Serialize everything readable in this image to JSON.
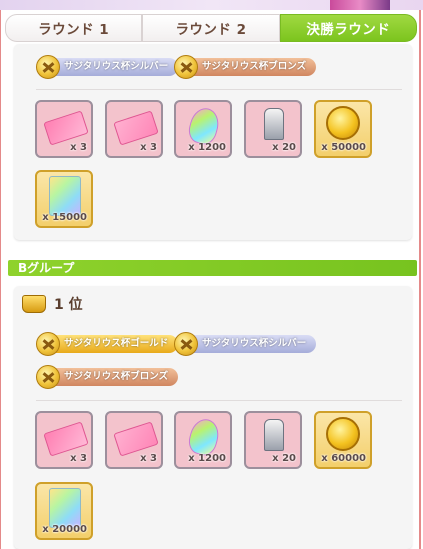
{
  "tabs": [
    "ラウンド 1",
    "ラウンド 2",
    "決勝ラウンド"
  ],
  "group_b": {
    "label": "Bグループ",
    "place_label": "1 位",
    "badges": [
      "サジタリウス杯ゴールド",
      "サジタリウス杯シルバー",
      "サジタリウス杯ブロンズ"
    ]
  },
  "section1": {
    "badges": [
      "サジタリウス杯シルバー",
      "サジタリウス杯ブロンズ"
    ],
    "items": [
      {
        "icon": "pink-ticket-icon",
        "qty": "x 3"
      },
      {
        "icon": "pink-ticket-icon",
        "qty": "x 3"
      },
      {
        "icon": "rainbow-carrot-icon",
        "qty": "x 1200"
      },
      {
        "icon": "silver-trophy-icon",
        "qty": "x 20"
      },
      {
        "icon": "gold-coin-icon",
        "qty": "x 50000"
      },
      {
        "icon": "rainbow-card-icon",
        "qty": "x 15000"
      }
    ]
  },
  "section2": {
    "items": [
      {
        "icon": "pink-ticket-icon",
        "qty": "x 3"
      },
      {
        "icon": "pink-ticket-icon",
        "qty": "x 3"
      },
      {
        "icon": "rainbow-carrot-icon",
        "qty": "x 1200"
      },
      {
        "icon": "silver-trophy-icon",
        "qty": "x 20"
      },
      {
        "icon": "gold-coin-icon",
        "qty": "x 60000"
      },
      {
        "icon": "rainbow-card-icon",
        "qty": "x 20000"
      }
    ]
  },
  "colors": {
    "accent_green": "#7cc41e",
    "frame_red": "#e48a8a"
  }
}
